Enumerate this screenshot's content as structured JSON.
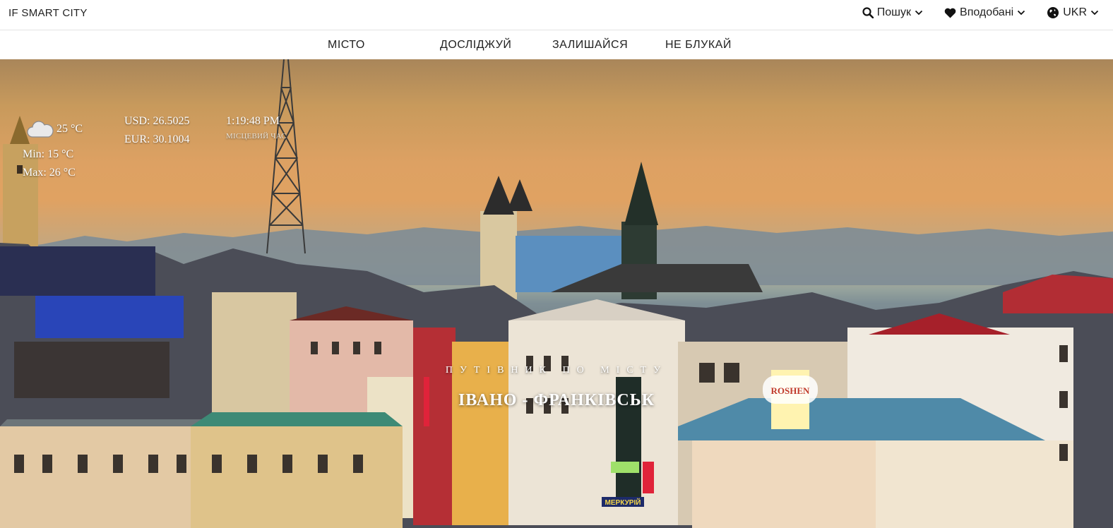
{
  "header": {
    "brand": "IF SMART CITY",
    "actions": [
      {
        "icon": "search-icon",
        "label": "Пошук"
      },
      {
        "icon": "heart-icon",
        "label": "Вподобані"
      },
      {
        "icon": "globe-icon",
        "label": "UKR"
      }
    ]
  },
  "nav": {
    "items": [
      "МІСТО",
      "ДОСЛІДЖУЙ",
      "ЗАЛИШАЙСЯ",
      "НЕ БЛУКАЙ"
    ]
  },
  "widgets": {
    "weather": {
      "temp": "25 °C",
      "min": "Min: 15 °C",
      "max": "Max: 26 °C",
      "icon": "cloud-icon"
    },
    "currency": {
      "usd": "USD: 26.5025",
      "eur": "EUR: 30.1004"
    },
    "time": {
      "value": "1:19:48 PM",
      "label": "МІСЦЕВИЙ ЧАС"
    }
  },
  "hero": {
    "subtitle": "ПУТІВНИК ПО МІСТУ",
    "title": "ІВАНО - ФРАНКІВСЬК",
    "sign": "ROSHEN",
    "shop_sign": "МЕРКУРІЙ"
  }
}
